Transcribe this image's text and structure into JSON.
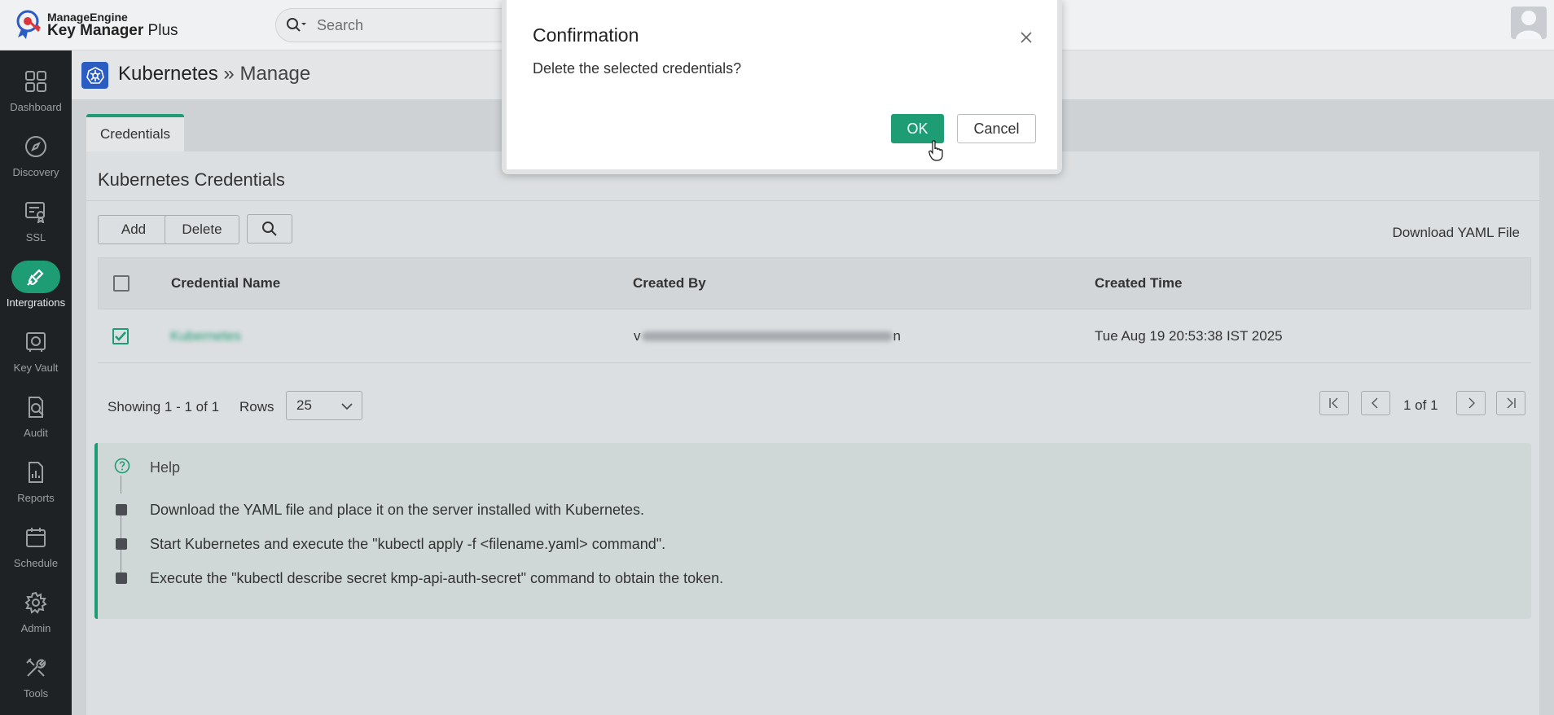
{
  "brand": {
    "line1": "ManageEngine",
    "line2_bold": "Key Manager",
    "line2_rest": " Plus"
  },
  "search": {
    "placeholder": "Search"
  },
  "sidebar": {
    "items": [
      {
        "label": "Dashboard",
        "icon": "grid-icon"
      },
      {
        "label": "Discovery",
        "icon": "compass-icon"
      },
      {
        "label": "SSL",
        "icon": "certificate-icon"
      },
      {
        "label": "Intergrations",
        "icon": "plug-icon",
        "active": true
      },
      {
        "label": "Key Vault",
        "icon": "vault-icon"
      },
      {
        "label": "Audit",
        "icon": "audit-icon"
      },
      {
        "label": "Reports",
        "icon": "report-icon"
      },
      {
        "label": "Schedule",
        "icon": "calendar-icon"
      },
      {
        "label": "Admin",
        "icon": "gear-icon"
      },
      {
        "label": "Tools",
        "icon": "tools-icon"
      }
    ]
  },
  "page": {
    "title": "Kubernetes",
    "separator": " » ",
    "subtitle": "Manage"
  },
  "tabs": [
    {
      "label": "Credentials"
    }
  ],
  "panel": {
    "title": "Kubernetes Credentials",
    "add_label": "Add",
    "delete_label": "Delete",
    "download_label": "Download YAML File"
  },
  "table": {
    "headers": [
      "Credential Name",
      "Created By",
      "Created Time"
    ],
    "rows": [
      {
        "checked": true,
        "name": "Kubernetes",
        "created_by_start": "v",
        "created_by_end": "n",
        "created_time": "Tue Aug 19 20:53:38 IST 2025"
      }
    ]
  },
  "pager": {
    "showing": "Showing 1 - 1 of 1",
    "rows_label": "Rows",
    "rows_value": "25",
    "page_info": "1 of 1"
  },
  "help": {
    "title": "Help",
    "steps": [
      "Download the YAML file and place it on the server installed with Kubernetes.",
      "Start Kubernetes and execute the \"kubectl apply -f <filename.yaml> command\".",
      "Execute the \"kubectl describe secret kmp-api-auth-secret\" command to obtain the token."
    ]
  },
  "modal": {
    "title": "Confirmation",
    "message": "Delete the selected credentials?",
    "ok_label": "OK",
    "cancel_label": "Cancel"
  },
  "colors": {
    "accent": "#1e9c73",
    "sidebar_bg": "#1e2224",
    "k8s_blue": "#2b5cc2"
  }
}
